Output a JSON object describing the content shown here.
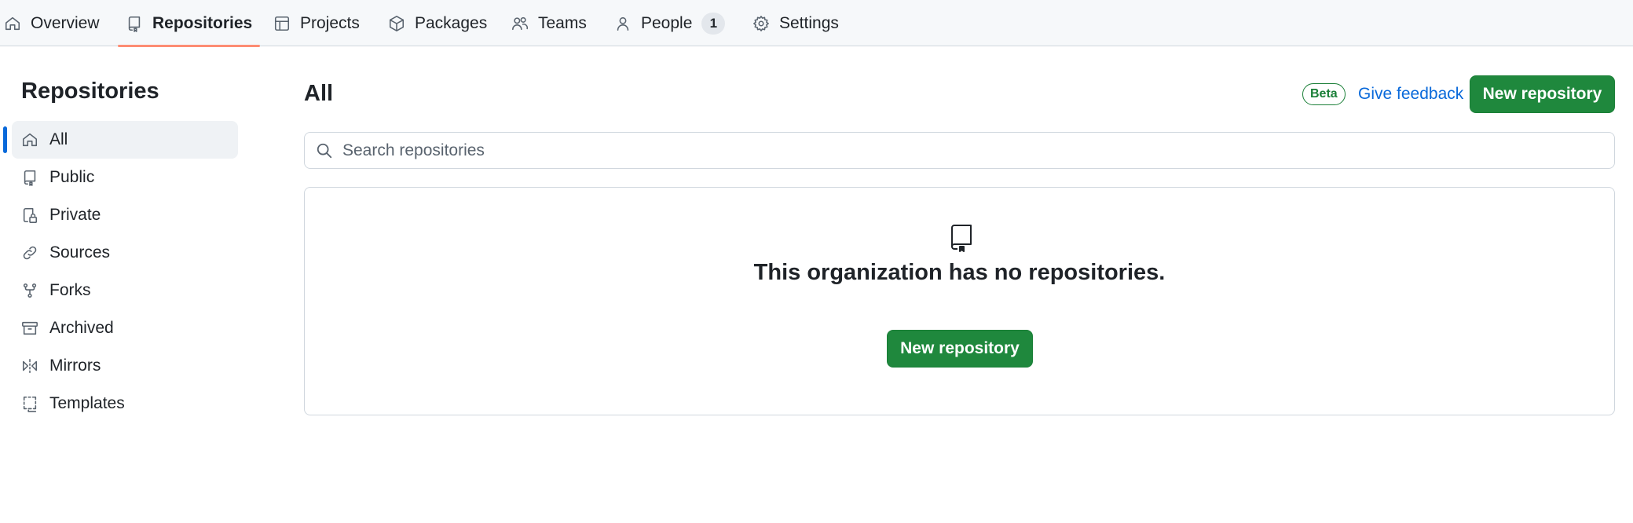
{
  "topnav": {
    "tabs": [
      {
        "label": "Overview",
        "icon": "home-icon"
      },
      {
        "label": "Repositories",
        "icon": "repo-icon",
        "selected": true
      },
      {
        "label": "Projects",
        "icon": "table-icon"
      },
      {
        "label": "Packages",
        "icon": "package-icon"
      },
      {
        "label": "Teams",
        "icon": "people-icon"
      },
      {
        "label": "People",
        "icon": "person-icon",
        "counter": "1"
      },
      {
        "label": "Settings",
        "icon": "gear-icon"
      }
    ]
  },
  "sidebar": {
    "title": "Repositories",
    "items": [
      {
        "label": "All",
        "icon": "home-icon",
        "active": true
      },
      {
        "label": "Public",
        "icon": "repo-icon"
      },
      {
        "label": "Private",
        "icon": "repo-locked-icon"
      },
      {
        "label": "Sources",
        "icon": "link-icon"
      },
      {
        "label": "Forks",
        "icon": "fork-icon"
      },
      {
        "label": "Archived",
        "icon": "archive-icon"
      },
      {
        "label": "Mirrors",
        "icon": "mirror-icon"
      },
      {
        "label": "Templates",
        "icon": "template-icon"
      }
    ]
  },
  "main": {
    "title": "All",
    "beta_label": "Beta",
    "feedback_label": "Give feedback",
    "new_repo_label": "New repository",
    "search": {
      "placeholder": "Search repositories",
      "value": ""
    },
    "blankslate": {
      "icon": "repo-icon",
      "message": "This organization has no repositories.",
      "button_label": "New repository"
    }
  },
  "colors": {
    "accent_blue": "#0969da",
    "primary_green": "#1f883d",
    "tab_underline": "#fd8c73"
  }
}
